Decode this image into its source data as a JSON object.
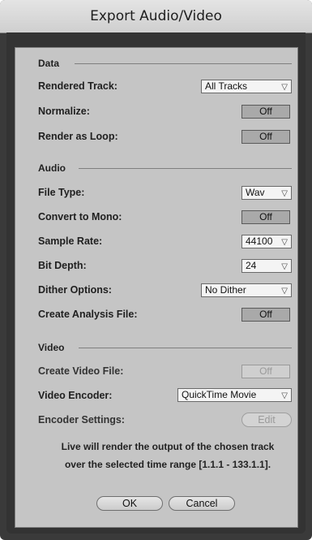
{
  "window": {
    "title": "Export Audio/Video"
  },
  "sections": {
    "data": "Data",
    "audio": "Audio",
    "video": "Video"
  },
  "data_section": {
    "rendered_track": {
      "label": "Rendered Track:",
      "value": "All Tracks"
    },
    "normalize": {
      "label": "Normalize:",
      "value": "Off"
    },
    "render_as_loop": {
      "label": "Render as Loop:",
      "value": "Off"
    }
  },
  "audio_section": {
    "file_type": {
      "label": "File Type:",
      "value": "Wav"
    },
    "convert_to_mono": {
      "label": "Convert to Mono:",
      "value": "Off"
    },
    "sample_rate": {
      "label": "Sample Rate:",
      "value": "44100"
    },
    "bit_depth": {
      "label": "Bit Depth:",
      "value": "24"
    },
    "dither_options": {
      "label": "Dither Options:",
      "value": "No Dither"
    },
    "create_analysis_file": {
      "label": "Create Analysis File:",
      "value": "Off"
    }
  },
  "video_section": {
    "create_video_file": {
      "label": "Create Video File:",
      "value": "Off"
    },
    "video_encoder": {
      "label": "Video Encoder:",
      "value": "QuickTime Movie"
    },
    "encoder_settings": {
      "label": "Encoder Settings:",
      "value": "Edit"
    }
  },
  "message": {
    "line1": "Live will render the output of the chosen track",
    "line2": "over the selected time range [1.1.1 - 133.1.1]."
  },
  "buttons": {
    "ok": "OK",
    "cancel": "Cancel"
  },
  "icons": {
    "dropdown": "chevron-down-icon"
  }
}
